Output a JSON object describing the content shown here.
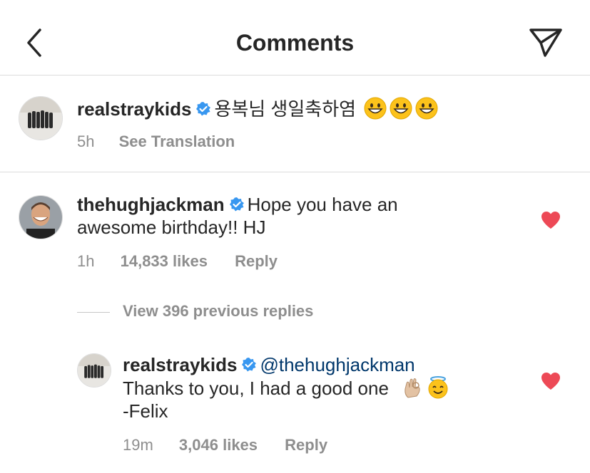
{
  "header": {
    "title": "Comments"
  },
  "caption": {
    "username": "realstraykids",
    "text": "용복님 생일축하염",
    "time": "5h",
    "translation_label": "See Translation"
  },
  "comment": {
    "username": "thehughjackman",
    "text_line1": "Hope you have an",
    "text_line2": "awesome birthday!! HJ",
    "time": "1h",
    "likes": "14,833 likes",
    "reply_label": "Reply"
  },
  "view_replies": {
    "label": "View 396 previous replies"
  },
  "reply": {
    "username": "realstraykids",
    "mention": "@thehughjackman",
    "text_line1": "Thanks to you, I had a good one",
    "text_line2": "-Felix",
    "time": "19m",
    "likes": "3,046 likes",
    "reply_label": "Reply"
  },
  "colors": {
    "heart": "#ed4956",
    "verified": "#3897f0",
    "secondary_text": "#8e8e8e",
    "mention": "#00376b"
  },
  "icons": [
    "back-arrow-icon",
    "send-icon",
    "verified-badge-icon",
    "heart-icon",
    "grinning-emoji-icon",
    "ok-hand-emoji-icon",
    "halo-smile-emoji-icon"
  ]
}
